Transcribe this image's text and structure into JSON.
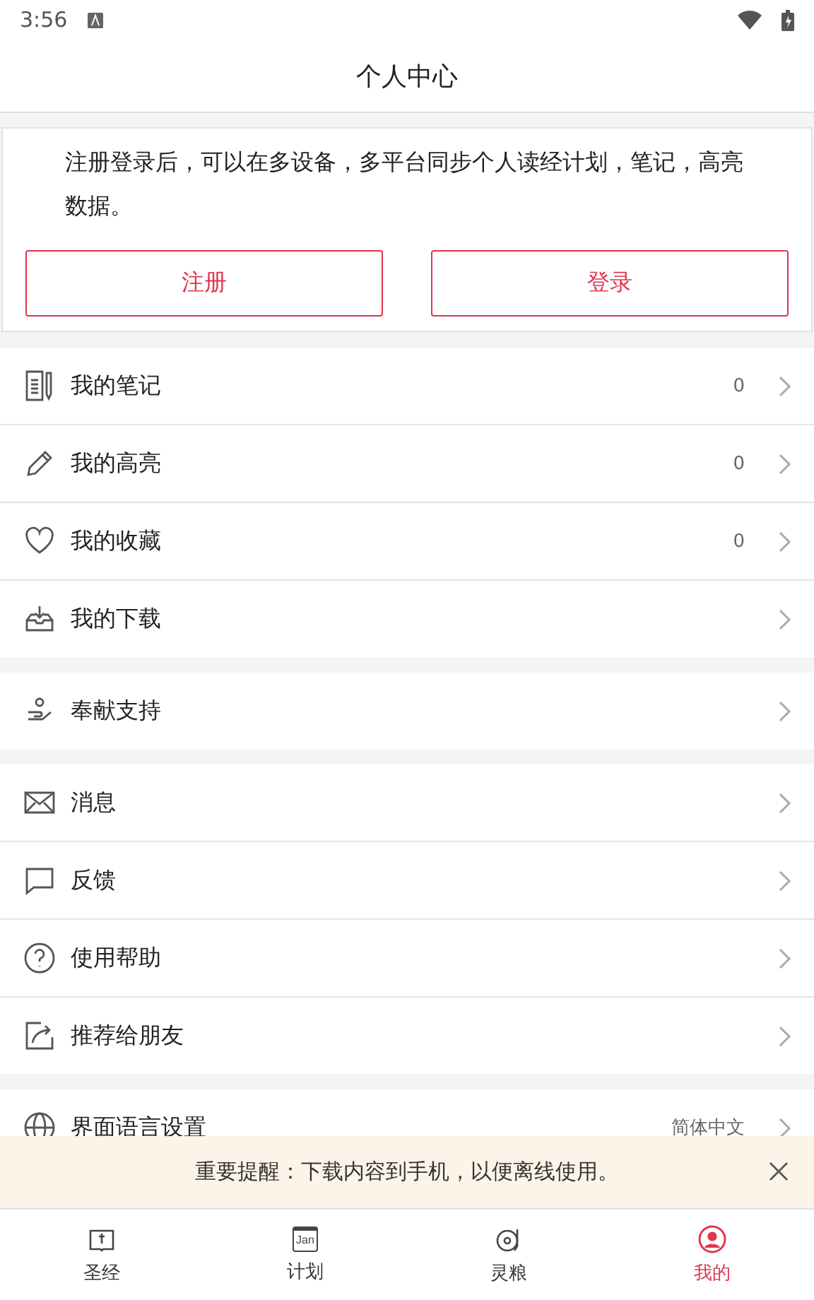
{
  "status_bar": {
    "time": "3:56"
  },
  "header": {
    "title": "个人中心"
  },
  "login_card": {
    "message": "注册登录后，可以在多设备，多平台同步个人读经计划，笔记，高亮数据。",
    "buttons": [
      "注册",
      "登录"
    ]
  },
  "groups": [
    {
      "items": [
        {
          "kind": "notes",
          "label": "我的笔记",
          "count": "0"
        },
        {
          "kind": "pencil",
          "label": "我的高亮",
          "count": "0"
        },
        {
          "kind": "heart",
          "label": "我的收藏",
          "count": "0"
        },
        {
          "kind": "download",
          "label": "我的下载"
        }
      ]
    },
    {
      "items": [
        {
          "kind": "give",
          "label": "奉献支持"
        }
      ]
    },
    {
      "items": [
        {
          "kind": "mail",
          "label": "消息"
        },
        {
          "kind": "chat",
          "label": "反馈"
        },
        {
          "kind": "help",
          "label": "使用帮助"
        },
        {
          "kind": "share",
          "label": "推荐给朋友"
        }
      ]
    },
    {
      "items": [
        {
          "kind": "globe",
          "label": "界面语言设置",
          "value": "简体中文"
        }
      ]
    }
  ],
  "banner": {
    "text": "重要提醒：下载内容到手机，以便离线使用。"
  },
  "tabs": [
    {
      "kind": "book",
      "label": "圣经",
      "selected": false
    },
    {
      "kind": "calendar",
      "label": "计划",
      "icon_text": "Jan",
      "selected": false
    },
    {
      "kind": "disc",
      "label": "灵粮",
      "selected": false
    },
    {
      "kind": "user",
      "label": "我的",
      "selected": true
    }
  ]
}
